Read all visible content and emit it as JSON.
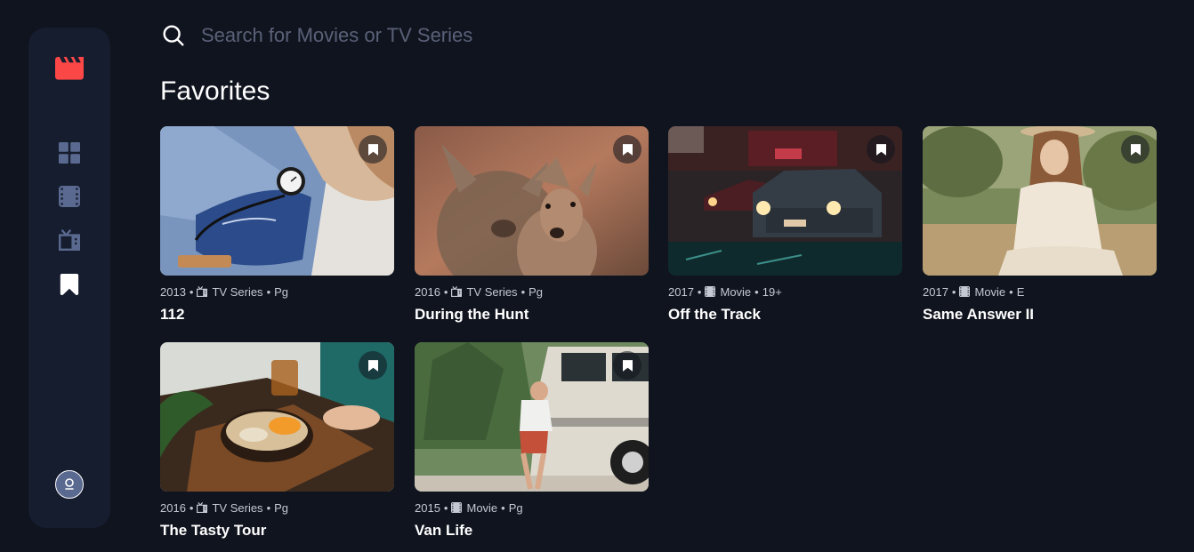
{
  "search": {
    "placeholder": "Search for Movies or TV Series",
    "value": ""
  },
  "section_title": "Favorites",
  "nav": {
    "logo_icon": "clapperboard-icon",
    "items": [
      {
        "name": "home",
        "icon": "grid-icon",
        "active": false
      },
      {
        "name": "movies",
        "icon": "film-icon",
        "active": false
      },
      {
        "name": "tv-series",
        "icon": "tv-icon",
        "active": false
      },
      {
        "name": "bookmarks",
        "icon": "bookmark-icon",
        "active": true
      }
    ],
    "avatar_icon": "user-avatar-icon"
  },
  "colors": {
    "background": "#10141e",
    "sidebar": "#161d2f",
    "accent": "#fc4747",
    "muted": "#5a698f"
  },
  "cards": [
    {
      "year": "2013",
      "category": "TV Series",
      "category_icon": "tv-icon",
      "rating": "Pg",
      "title": "112",
      "image": "hospital-blood-pressure"
    },
    {
      "year": "2016",
      "category": "TV Series",
      "category_icon": "tv-icon",
      "rating": "Pg",
      "title": "During the Hunt",
      "image": "deer"
    },
    {
      "year": "2017",
      "category": "Movie",
      "category_icon": "film-icon",
      "rating": "19+",
      "title": "Off the Track",
      "image": "cars-night"
    },
    {
      "year": "2017",
      "category": "Movie",
      "category_icon": "film-icon",
      "rating": "E",
      "title": "Same Answer II",
      "image": "woman-field"
    },
    {
      "year": "2016",
      "category": "TV Series",
      "category_icon": "tv-icon",
      "rating": "Pg",
      "title": "The Tasty Tour",
      "image": "food-bowl"
    },
    {
      "year": "2015",
      "category": "Movie",
      "category_icon": "film-icon",
      "rating": "Pg",
      "title": "Van Life",
      "image": "van"
    }
  ]
}
